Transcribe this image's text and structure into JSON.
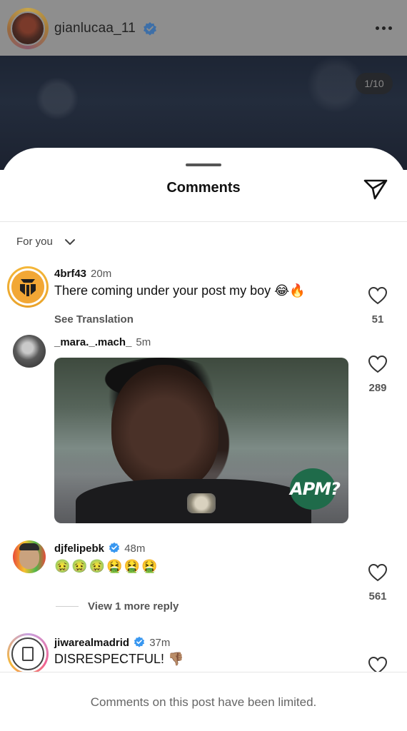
{
  "post": {
    "username": "gianlucaa_11",
    "verified": true,
    "page_counter": "1/10"
  },
  "sheet": {
    "title": "Comments",
    "sort_label": "For you"
  },
  "comments": [
    {
      "username": "4brf43",
      "time": "20m",
      "text": "There coming under your post my boy",
      "emoji": "😂🔥",
      "sub_action": "See Translation",
      "likes": "51"
    },
    {
      "username": "_mara._.mach_",
      "time": "5m",
      "gif_label": "APM?",
      "likes": "289"
    },
    {
      "username": "djfelipebk",
      "verified": true,
      "time": "48m",
      "emoji": "🤢🤢🤢🤮🤮🤮",
      "likes": "561",
      "view_replies": "View 1 more reply"
    },
    {
      "username": "jiwarealmadrid",
      "verified": true,
      "time": "37m",
      "text": "DISRESPECTFUL!",
      "emoji": "👎🏽"
    }
  ],
  "footer": {
    "limited_notice": "Comments on this post have been limited."
  },
  "colors": {
    "verified_blue": "#3897f0",
    "text_primary": "#111111",
    "text_secondary": "#555555"
  },
  "icons": [
    "more-dots-icon",
    "share-icon",
    "chevron-down-icon",
    "heart-icon",
    "verified-badge-icon"
  ]
}
